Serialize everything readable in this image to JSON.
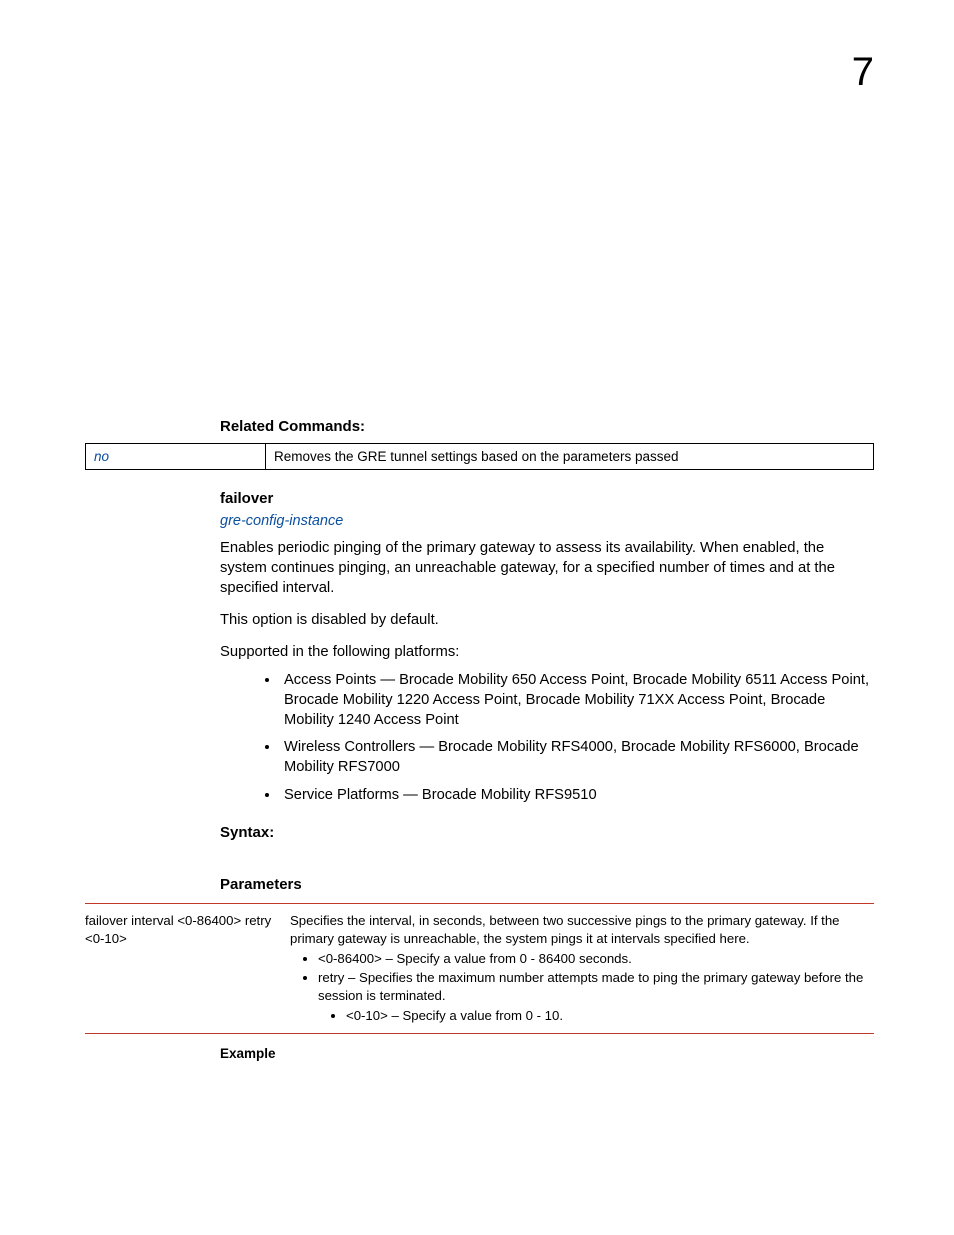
{
  "chapter": "7",
  "sections": {
    "related_commands": {
      "title": "Related Commands:",
      "rows": [
        {
          "cmd": "no",
          "desc": "Removes the GRE tunnel settings based on the parameters passed"
        }
      ]
    },
    "failover": {
      "title": "failover",
      "link": "gre-config-instance",
      "para1": "Enables periodic pinging of the primary gateway to assess its availability. When enabled, the system continues pinging, an unreachable gateway, for a specified number of times and at the specified interval.",
      "para2": "This option is disabled by default.",
      "para3": "Supported in the following platforms:",
      "bullets": [
        "Access Points — Brocade Mobility 650 Access Point, Brocade Mobility 6511 Access Point, Brocade Mobility 1220 Access Point, Brocade Mobility 71XX Access Point, Brocade Mobility 1240 Access Point",
        "Wireless Controllers — Brocade Mobility RFS4000, Brocade Mobility RFS6000, Brocade Mobility RFS7000",
        "Service Platforms — Brocade Mobility RFS9510"
      ]
    },
    "syntax": {
      "title": "Syntax:"
    },
    "parameters": {
      "title": "Parameters",
      "left": "failover interval <0-86400> retry <0-10>",
      "right_intro": "Specifies the interval, in seconds, between two successive pings to the primary gateway. If the primary gateway is unreachable, the system pings it at intervals specified here.",
      "right_b1": "<0-86400> – Specify a value from 0 - 86400 seconds.",
      "right_b2": "retry – Specifies the maximum number attempts made to ping the primary gateway before the session is terminated.",
      "right_b2_sub": "<0-10> – Specify a value from 0 - 10."
    },
    "example": {
      "title": "Example"
    }
  }
}
